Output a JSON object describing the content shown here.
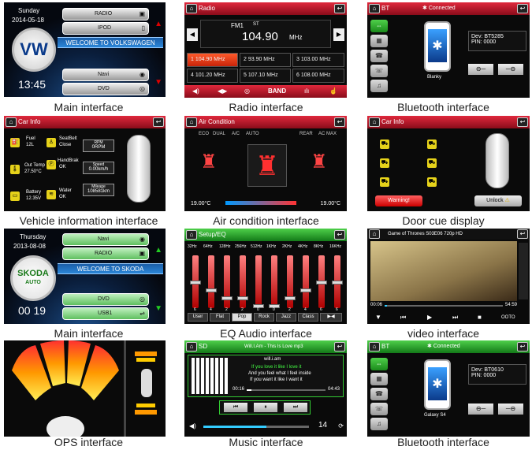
{
  "captions": [
    "Main interface",
    "Radio interface",
    "Bluetooth interface",
    "Vehicle information interface",
    "Air condition interface",
    "Door cue display",
    "Main interface",
    "EQ Audio interface",
    "video interface",
    "OPS interface",
    "Music interface",
    "Bluetooth interface"
  ],
  "main1": {
    "day": "Sunday",
    "date": "2014-05-18",
    "time": "13:45",
    "welcome": "WELCOME TO VOLKSWAGEN",
    "btns": [
      "RADIO",
      "IPOD",
      "Navi",
      "DVD"
    ]
  },
  "radio": {
    "title": "Radio",
    "band": "FM1",
    "st": "ST",
    "freq": "104.90",
    "unit": "MHz",
    "presets": [
      "1 104.90 MHz",
      "2  93.90 MHz",
      "3  103.00 MHz",
      "4  101.20 MHz",
      "5  107.10 MHz",
      "6  108.00 MHz"
    ],
    "band_btn": "BAND"
  },
  "bt1": {
    "title": "BT",
    "status": "Connected",
    "dev": "Dev: BT5285",
    "pin": "PIN: 0000",
    "name": "Blanky"
  },
  "carinfo": {
    "title": "Car Info",
    "labels": [
      "Fuel",
      "12L",
      "SeatBelt",
      "Close",
      "Out Temp",
      "27.50°C",
      "HandBrak",
      "OK",
      "Battery",
      "12.35V",
      "Water",
      "OK"
    ],
    "rpm": "0RPM",
    "speed": "0.00km/h",
    "mileage": "108581km",
    "rpm_label": "RPM",
    "speed_label": "Speed",
    "mileage_label": "Mileage"
  },
  "air": {
    "title": "Air Condition",
    "modes": [
      "ECO",
      "DUAL",
      "A/C",
      "AUTO",
      "REAR",
      "AC",
      "MAX"
    ],
    "left_temp": "19.00°C",
    "right_temp": "19.00°C"
  },
  "door": {
    "title": "Car Info",
    "warn": "Warning!",
    "unlock": "Unlock"
  },
  "main2": {
    "day": "Thursday",
    "date": "2013-08-08",
    "time": "00 19",
    "welcome": "WELCOME TO SKODA",
    "btns": [
      "Navi",
      "RADIO",
      "DVD",
      "USB1"
    ],
    "logo": "SKODA",
    "logo_sub": "AUTO"
  },
  "eq": {
    "title": "Setup/EQ",
    "freqs": [
      "32Hz",
      "64Hz",
      "128Hz",
      "256Hz",
      "512Hz",
      "1KHz",
      "2KHz",
      "4KHz",
      "8KHz",
      "16KHz"
    ],
    "vals": [
      "6",
      "4",
      "2",
      "2",
      "0",
      "0",
      "2",
      "4",
      "6",
      "6"
    ],
    "presets": [
      "User",
      "Flat",
      "Pop",
      "Rock",
      "Jazz",
      "Class"
    ],
    "selected": "Pop"
  },
  "video": {
    "title": "Game of Thrones S03E06 720p HD",
    "time_cur": "00:06",
    "time_total": "54:59",
    "ch": "OOTO"
  },
  "music": {
    "title": "SD",
    "song": "Will.I.Am - This Is Love mp3",
    "artist": "will.i.am",
    "lyric1": "If you love it like I love it",
    "lyric2": "And you feel what I feel inside",
    "lyric3": "If you want it like I want it",
    "t_cur": "00:16",
    "t_total": "04:43",
    "vol": "14"
  },
  "bt2": {
    "title": "BT",
    "status": "Connected",
    "dev": "Dev: BT0610",
    "pin": "PIN: 0000",
    "name": "Galaxy S4"
  }
}
